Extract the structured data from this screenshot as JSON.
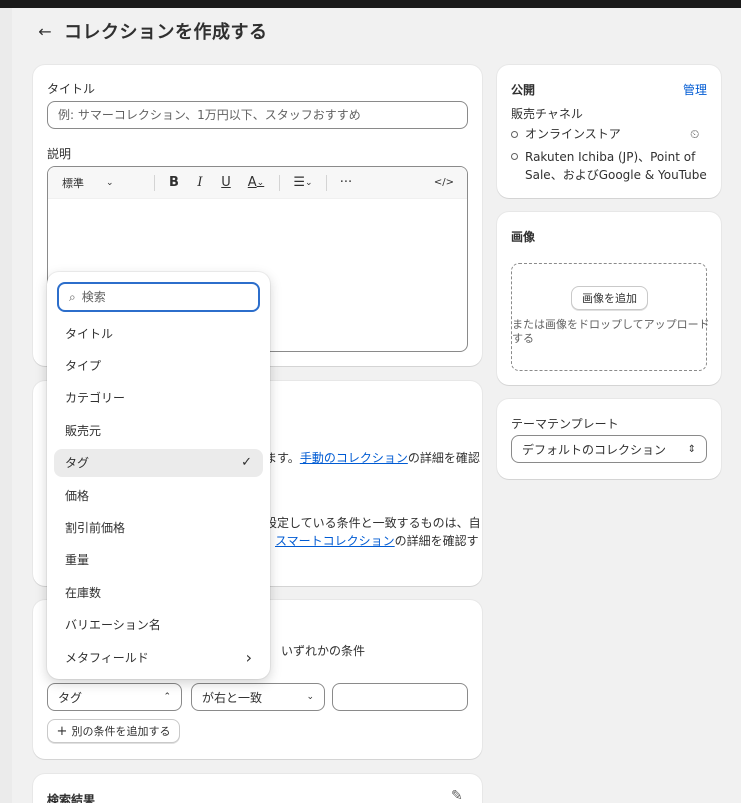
{
  "header": {
    "back_icon": "arrow-left-icon",
    "title": "コレクションを作成する"
  },
  "title_section": {
    "label": "タイトル",
    "placeholder": "例: サマーコレクション、1万円以下、スタッフおすすめ",
    "value": ""
  },
  "description": {
    "label": "説明",
    "format_label": "標準",
    "toolbar_icons": [
      "bold-icon",
      "italic-icon",
      "underline-icon",
      "text-color-icon",
      "align-icon",
      "more-icon",
      "code-icon"
    ],
    "bold": "B",
    "italic": "I",
    "underline": "U",
    "color": "A",
    "more": "···",
    "code": "</>"
  },
  "collection_type": {
    "manual_text": "ます。",
    "manual_link": "手動のコレクション",
    "manual_suffix": "の詳細を確認",
    "smart_text": "設定している条件と一致するものは、自",
    "smart_link": "スマートコレクション",
    "smart_suffix": "の詳細を確認す"
  },
  "conditions": {
    "any_condition_label": "いずれかの条件",
    "field_value": "タグ",
    "operator_value": "が右と一致",
    "value_input": "",
    "add_button_label": "別の条件を追加する"
  },
  "search_results": {
    "label": "検索結果"
  },
  "publishing": {
    "title": "公開",
    "manage_link": "管理",
    "channels_label": "販売チャネル",
    "channel_1": "オンラインストア",
    "channel_2_line1": "Rakuten Ichiba (JP)、Point of",
    "channel_2_line2": "Sale、およびGoogle & YouTube"
  },
  "image": {
    "title": "画像",
    "add_button": "画像を追加",
    "drop_text_line1": "または画像をドロップしてアップロード",
    "drop_text_line2": "する"
  },
  "theme_template": {
    "label": "テーマテンプレート",
    "value": "デフォルトのコレクション"
  },
  "dropdown": {
    "search_placeholder": "検索",
    "items": [
      {
        "label": "タイトル"
      },
      {
        "label": "タイプ"
      },
      {
        "label": "カテゴリー"
      },
      {
        "label": "販売元"
      },
      {
        "label": "タグ",
        "selected": true
      },
      {
        "label": "価格"
      },
      {
        "label": "割引前価格"
      },
      {
        "label": "重量"
      },
      {
        "label": "在庫数"
      },
      {
        "label": "バリエーション名"
      },
      {
        "label": "メタフィールド",
        "has_submenu": true
      }
    ]
  }
}
